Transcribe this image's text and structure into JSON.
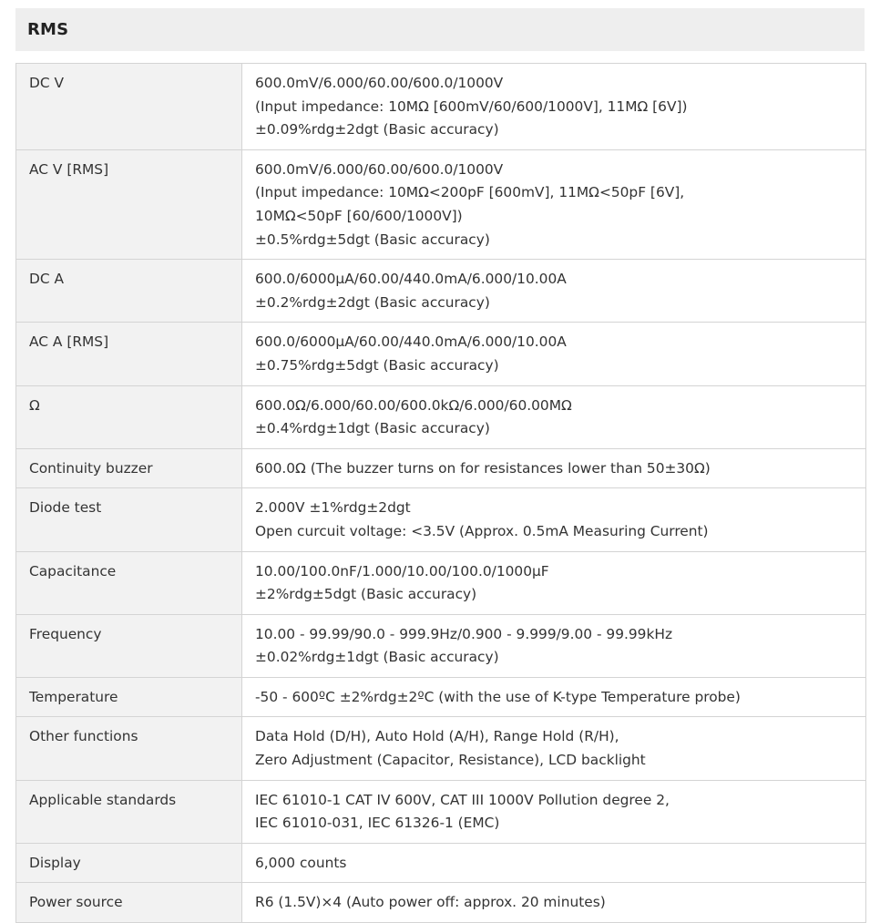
{
  "header": {
    "title": "RMS"
  },
  "rows": [
    {
      "label": "DC V",
      "lines": [
        "600.0mV/6.000/60.00/600.0/1000V",
        "(Input impedance: 10MΩ [600mV/60/600/1000V], 11MΩ [6V])",
        "±0.09%rdg±2dgt (Basic accuracy)"
      ]
    },
    {
      "label": "AC V [RMS]",
      "lines": [
        "600.0mV/6.000/60.00/600.0/1000V",
        "(Input impedance: 10MΩ<200pF [600mV], 11MΩ<50pF [6V],",
        "10MΩ<50pF [60/600/1000V])",
        "±0.5%rdg±5dgt (Basic accuracy)"
      ]
    },
    {
      "label": "DC A",
      "lines": [
        "600.0/6000μA/60.00/440.0mA/6.000/10.00A",
        "±0.2%rdg±2dgt (Basic accuracy)"
      ]
    },
    {
      "label": "AC A [RMS]",
      "lines": [
        "600.0/6000μA/60.00/440.0mA/6.000/10.00A",
        "±0.75%rdg±5dgt (Basic accuracy)"
      ]
    },
    {
      "label": "Ω",
      "lines": [
        "600.0Ω/6.000/60.00/600.0kΩ/6.000/60.00MΩ",
        "±0.4%rdg±1dgt (Basic accuracy)"
      ]
    },
    {
      "label": "Continuity buzzer",
      "lines": [
        "600.0Ω (The buzzer turns on for resistances lower than 50±30Ω)"
      ]
    },
    {
      "label": "Diode test",
      "lines": [
        "2.000V ±1%rdg±2dgt",
        "Open curcuit voltage: <3.5V (Approx. 0.5mA Measuring Current)"
      ]
    },
    {
      "label": "Capacitance",
      "lines": [
        "10.00/100.0nF/1.000/10.00/100.0/1000μF",
        "±2%rdg±5dgt (Basic accuracy)"
      ]
    },
    {
      "label": "Frequency",
      "lines": [
        "10.00 - 99.99/90.0 - 999.9Hz/0.900 - 9.999/9.00 - 99.99kHz",
        "±0.02%rdg±1dgt (Basic accuracy)"
      ]
    },
    {
      "label": "Temperature",
      "lines": [
        "-50 - 600ºC ±2%rdg±2ºC (with the use of K-type Temperature probe)"
      ]
    },
    {
      "label": "Other functions",
      "lines": [
        "Data Hold (D/H), Auto Hold (A/H), Range Hold (R/H),",
        "Zero Adjustment (Capacitor, Resistance), LCD backlight"
      ]
    },
    {
      "label": "Applicable standards",
      "lines": [
        "IEC 61010-1 CAT IV 600V, CAT III 1000V Pollution degree 2,",
        "IEC 61010-031, IEC 61326-1 (EMC)"
      ]
    },
    {
      "label": "Display",
      "lines": [
        "6,000 counts"
      ]
    },
    {
      "label": "Power source",
      "lines": [
        "R6 (1.5V)×4 (Auto power off: approx. 20 minutes)"
      ]
    }
  ]
}
